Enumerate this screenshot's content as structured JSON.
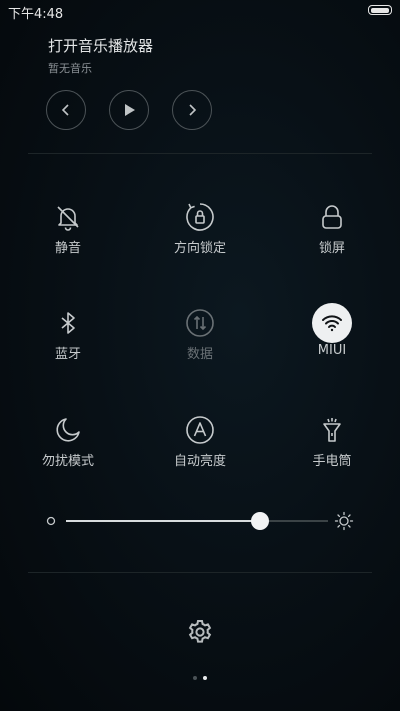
{
  "status_bar": {
    "time": "下午4:48"
  },
  "music": {
    "title": "打开音乐播放器",
    "subtitle": "暂无音乐",
    "controls": [
      "previous-icon",
      "play-icon",
      "next-icon"
    ]
  },
  "toggles": [
    {
      "label": "静音",
      "icon": "bell-off-icon",
      "state": "off"
    },
    {
      "label": "方向锁定",
      "icon": "rotation-lock-icon",
      "state": "off"
    },
    {
      "label": "锁屏",
      "icon": "lock-icon",
      "state": "off"
    },
    {
      "label": "蓝牙",
      "icon": "bluetooth-icon",
      "state": "off"
    },
    {
      "label": "数据",
      "icon": "mobile-data-icon",
      "state": "disabled"
    },
    {
      "label": "MIUI",
      "icon": "wifi-icon",
      "state": "on"
    },
    {
      "label": "勿扰模式",
      "icon": "moon-icon",
      "state": "off"
    },
    {
      "label": "自动亮度",
      "icon": "auto-brightness-icon",
      "state": "off"
    },
    {
      "label": "手电筒",
      "icon": "flashlight-icon",
      "state": "off"
    }
  ],
  "brightness": {
    "level": 0.74
  },
  "pager": {
    "total": 2,
    "current": 2
  },
  "colors": {
    "active_tile": "#eef0f1",
    "text": "#c6cacc",
    "dim_text": "#6a7175"
  }
}
